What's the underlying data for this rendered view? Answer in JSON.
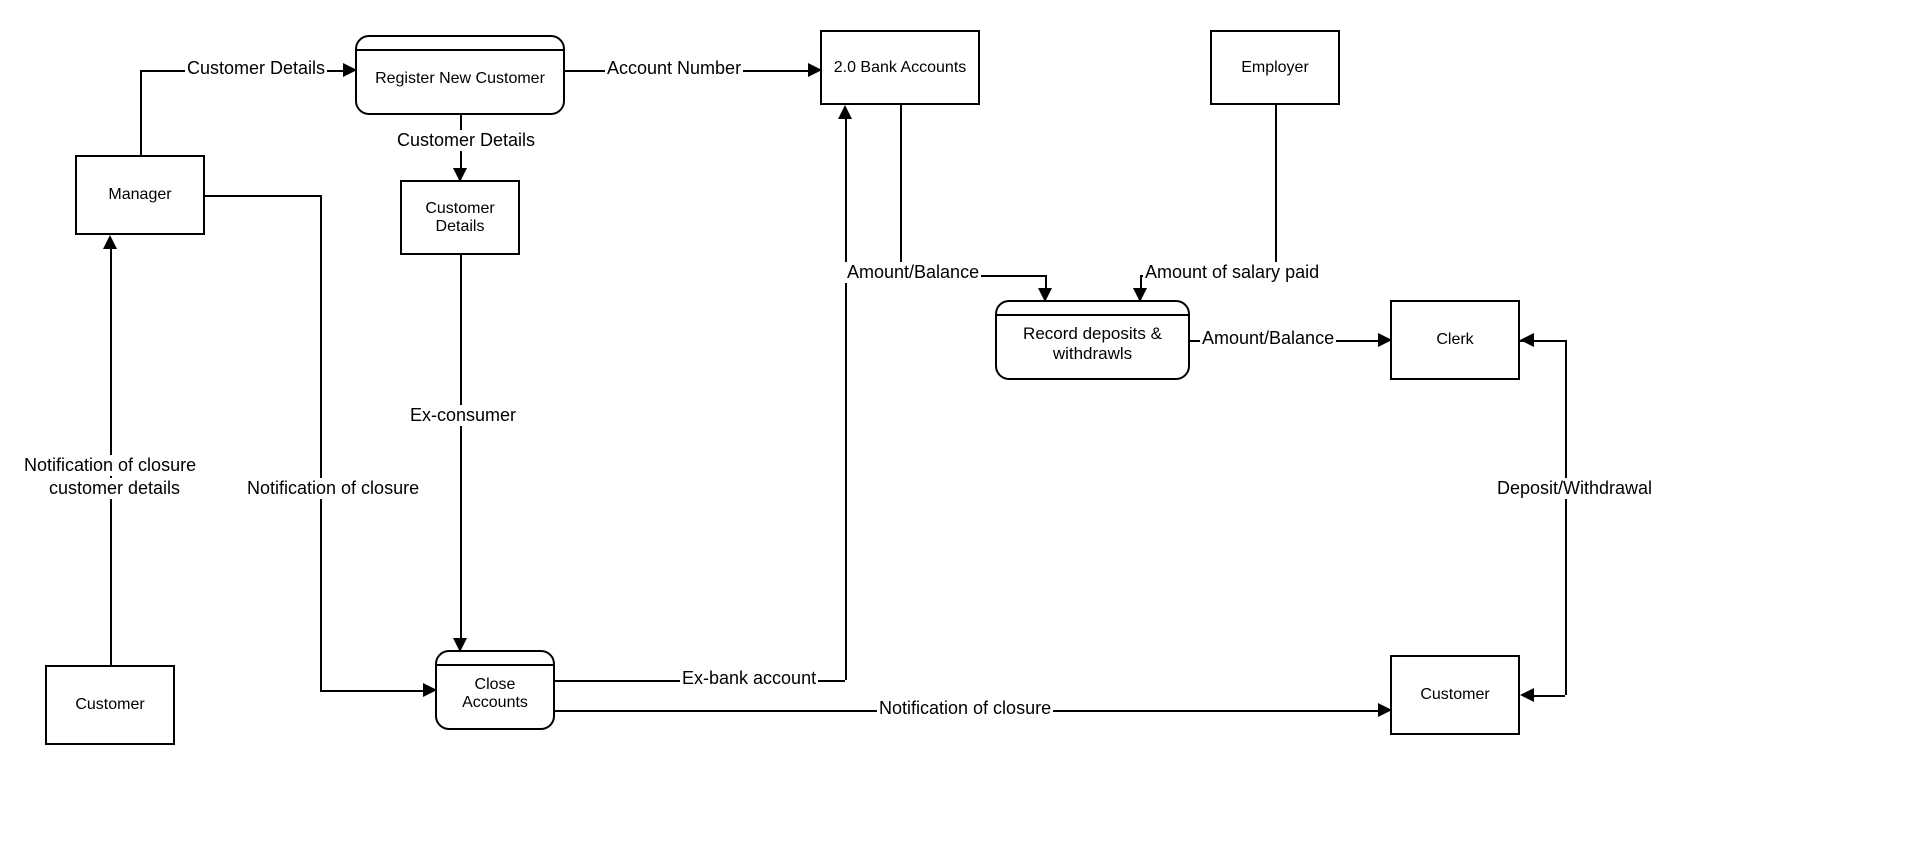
{
  "nodes": {
    "manager": {
      "label": "Manager"
    },
    "customer_left": {
      "label": "Customer"
    },
    "register": {
      "label": "Register New Customer"
    },
    "cust_details_store": {
      "label": "Customer Details"
    },
    "close_accounts": {
      "label": "Close Accounts"
    },
    "bank_accounts": {
      "label": "2.0 Bank Accounts"
    },
    "employer": {
      "label": "Employer"
    },
    "record": {
      "label": "Record deposits & withdrawls"
    },
    "clerk": {
      "label": "Clerk"
    },
    "customer_right": {
      "label": "Customer"
    }
  },
  "edges": {
    "mgr_to_reg": {
      "label": "Customer Details"
    },
    "reg_to_bank": {
      "label": "Account Number"
    },
    "reg_to_store": {
      "label": "Customer Details"
    },
    "store_to_close": {
      "label": "Ex-consumer"
    },
    "mgr_to_close": {
      "label": "Notification of closure"
    },
    "close_to_bank": {
      "label": "Ex-bank account"
    },
    "close_to_cust_right": {
      "label": "Notification of closure"
    },
    "cust_to_mgr": {
      "label1": "Notification of closure",
      "label2": "customer details"
    },
    "bank_to_record": {
      "label": "Amount/Balance"
    },
    "employer_to_record": {
      "label": "Amount of salary paid"
    },
    "record_to_clerk": {
      "label": "Amount/Balance"
    },
    "clerk_cust": {
      "label": "Deposit/Withdrawal"
    }
  }
}
